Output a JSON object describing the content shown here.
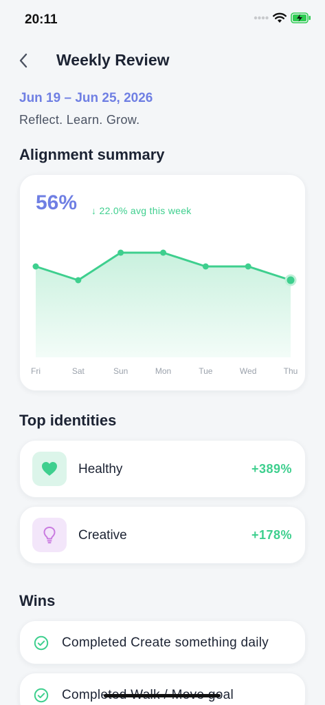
{
  "status_bar": {
    "time": "20:11"
  },
  "header": {
    "title": "Weekly Review"
  },
  "date_range": "Jun 19 – Jun 25, 2026",
  "tagline": "Reflect. Learn. Grow.",
  "alignment": {
    "section_title": "Alignment summary",
    "percent": "56%",
    "delta": "↓ 22.0% avg this week"
  },
  "chart_data": {
    "type": "area",
    "categories": [
      "Fri",
      "Sat",
      "Sun",
      "Mon",
      "Tue",
      "Wed",
      "Thu"
    ],
    "series": [
      {
        "values": [
          66,
          56,
          76,
          76,
          66,
          66,
          56
        ]
      }
    ],
    "ylim": [
      0,
      100
    ],
    "grid": false,
    "colors": {
      "line": "#3ecf8e",
      "fill_top": "#c9f1de",
      "fill_bottom": "#f3fcf8",
      "tick": "#9aa1ab"
    }
  },
  "top_identities": {
    "section_title": "Top identities",
    "items": [
      {
        "name": "Healthy",
        "change": "+389%",
        "icon": "heart-icon",
        "icon_color": "#3ecf8e",
        "icon_bg": "#dcf5ea"
      },
      {
        "name": "Creative",
        "change": "+178%",
        "icon": "lightbulb-icon",
        "icon_color": "#c97ae0",
        "icon_bg": "#f3e6fa"
      }
    ]
  },
  "wins": {
    "section_title": "Wins",
    "items": [
      {
        "text": "Completed Create something daily"
      },
      {
        "text": "Completed Walk / Move goal"
      }
    ]
  }
}
